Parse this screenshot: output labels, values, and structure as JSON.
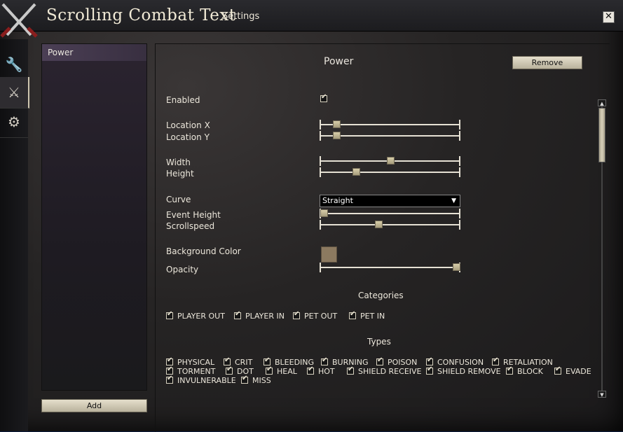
{
  "window": {
    "title": "Scrolling Combat Text",
    "subtitle": "Settings",
    "close_label": "✕"
  },
  "sidebar_tabs": [
    {
      "icon": "wrench-icon",
      "glyph": "🔧"
    },
    {
      "icon": "crossed-swords-icon",
      "glyph": "⚔"
    },
    {
      "icon": "gear-icon",
      "glyph": "⚙"
    }
  ],
  "left_panel": {
    "items": [
      "Power"
    ],
    "add_label": "Add"
  },
  "main": {
    "title": "Power",
    "remove_label": "Remove",
    "enabled_label": "Enabled",
    "enabled_checked": true,
    "location_x_label": "Location X",
    "location_x_value": 0.12,
    "location_y_label": "Location Y",
    "location_y_value": 0.12,
    "width_label": "Width",
    "width_value": 0.5,
    "height_label": "Height",
    "height_value": 0.26,
    "curve_label": "Curve",
    "curve_value": "Straight",
    "event_height_label": "Event Height",
    "event_height_value": 0.03,
    "scrollspeed_label": "Scrollspeed",
    "scrollspeed_value": 0.42,
    "background_color_label": "Background Color",
    "background_color": "#8c7a60",
    "opacity_label": "Opacity",
    "opacity_value": 0.97,
    "categories_heading": "Categories",
    "categories": [
      "PLAYER OUT",
      "PLAYER IN",
      "PET OUT",
      "PET IN"
    ],
    "types_heading": "Types",
    "types_row1": [
      "PHYSICAL",
      "CRIT",
      "BLEEDING",
      "BURNING",
      "POISON",
      "CONFUSION",
      "RETALIATION"
    ],
    "types_row2": [
      "TORMENT",
      "DOT",
      "HEAL",
      "HOT",
      "SHIELD RECEIVE",
      "SHIELD REMOVE",
      "BLOCK",
      "EVADE"
    ],
    "types_row3": [
      "INVULNERABLE",
      "MISS"
    ]
  },
  "scroll": {
    "up_glyph": "▲",
    "down_glyph": "▼"
  }
}
